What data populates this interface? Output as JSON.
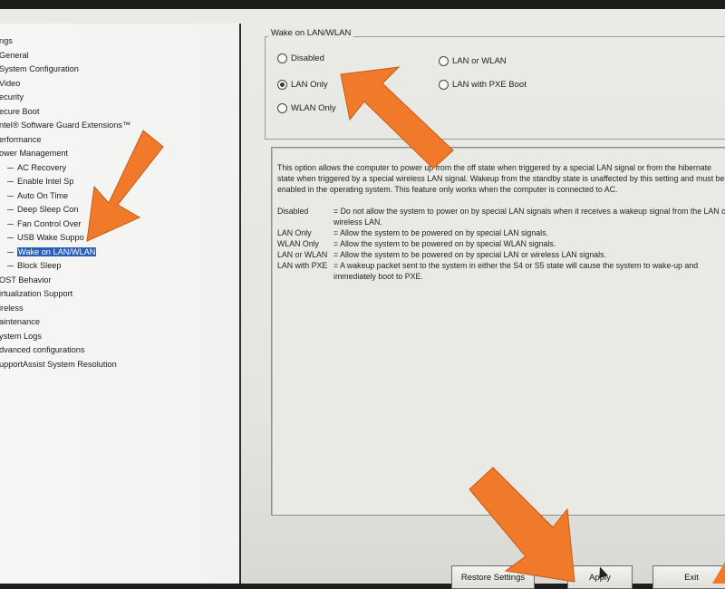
{
  "tree": {
    "items": [
      {
        "label": "ngs",
        "level": 0
      },
      {
        "label": "General",
        "level": 0
      },
      {
        "label": "System Configuration",
        "level": 0
      },
      {
        "label": "Video",
        "level": 0
      },
      {
        "label": "ecurity",
        "level": 0
      },
      {
        "label": "ecure Boot",
        "level": 0
      },
      {
        "label": "ntel® Software Guard Extensions™",
        "level": 0
      },
      {
        "label": "erformance",
        "level": 0
      },
      {
        "label": "ower Management",
        "level": 0
      },
      {
        "label": "AC Recovery",
        "level": 1
      },
      {
        "label": "Enable Intel Sp",
        "level": 1
      },
      {
        "label": "Auto On Time",
        "level": 1
      },
      {
        "label": "Deep Sleep Con",
        "level": 1
      },
      {
        "label": "Fan Control Over",
        "level": 1
      },
      {
        "label": "USB Wake Suppo",
        "level": 1
      },
      {
        "label": "Wake on LAN/WLAN",
        "level": 1,
        "selected": true
      },
      {
        "label": "Block Sleep",
        "level": 1
      },
      {
        "label": "OST Behavior",
        "level": 0
      },
      {
        "label": "irtualization Support",
        "level": 0
      },
      {
        "label": "ireless",
        "level": 0
      },
      {
        "label": "aintenance",
        "level": 0
      },
      {
        "label": "ystem Logs",
        "level": 0
      },
      {
        "label": "dvanced configurations",
        "level": 0
      },
      {
        "label": "upportAssist System Resolution",
        "level": 0
      }
    ]
  },
  "group": {
    "title": "Wake on LAN/WLAN",
    "options": [
      {
        "label": "Disabled",
        "checked": false
      },
      {
        "label": "LAN Only",
        "checked": true
      },
      {
        "label": "WLAN Only",
        "checked": false
      },
      {
        "label": "LAN or WLAN",
        "checked": false
      },
      {
        "label": "LAN with PXE Boot",
        "checked": false
      }
    ]
  },
  "help": {
    "paragraph": "This option allows the computer to power up from the off state when triggered by a special LAN signal or from the hibernate state when triggered by a special wireless LAN signal. Wakeup from the standby state is unaffected by this setting and must be enabled in the operating system. This feature only works when the computer is connected to AC.",
    "definitions": [
      {
        "term": "Disabled",
        "desc": "= Do not allow the system to power on by special LAN signals when it receives a wakeup signal from the LAN or wireless LAN."
      },
      {
        "term": "LAN Only",
        "desc": "= Allow the system to be powered on by special LAN signals."
      },
      {
        "term": "WLAN Only",
        "desc": "= Allow the system to be powered on by special WLAN signals."
      },
      {
        "term": "LAN or WLAN",
        "desc": "= Allow the system to be powered on by special LAN or wireless LAN signals."
      },
      {
        "term": "LAN with PXE",
        "desc": "= A wakeup packet sent to the system in either the S4 or S5 state will cause the system to wake-up and immediately boot to PXE."
      }
    ]
  },
  "buttons": {
    "restore": "Restore Settings",
    "apply": "Apply",
    "exit": "Exit"
  },
  "colors": {
    "selection": "#2a5fb8",
    "arrow": "#f07a2a"
  }
}
